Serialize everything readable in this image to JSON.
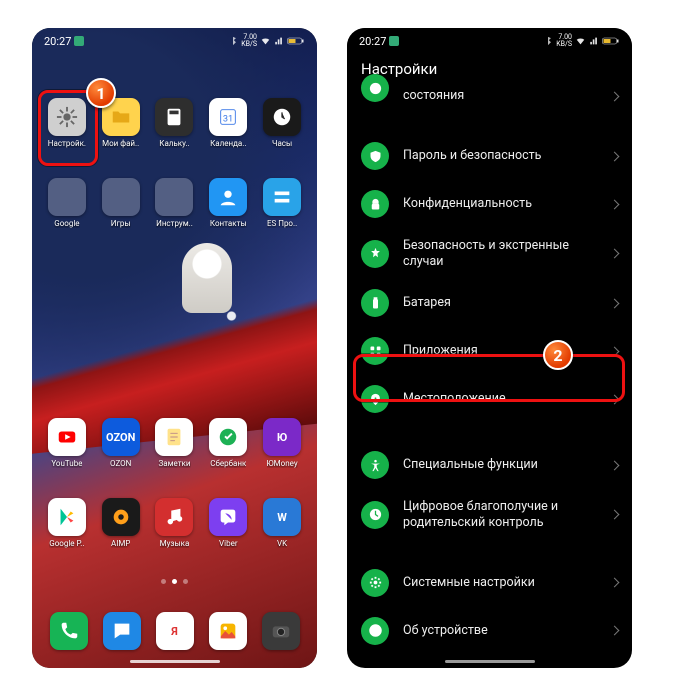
{
  "status": {
    "time": "20:27",
    "speed_top": "7.00",
    "speed_bottom": "KB/S"
  },
  "home": {
    "row1": [
      {
        "name": "settings",
        "label": "Настройк.",
        "bg": "#cfcfcf",
        "glyph": "gear"
      },
      {
        "name": "my-files",
        "label": "Мои фай..",
        "bg": "#ffd34d",
        "glyph": "folder"
      },
      {
        "name": "calculator",
        "label": "Кальку..",
        "bg": "#2e2e2e",
        "glyph": "calc"
      },
      {
        "name": "calendar",
        "label": "Календа..",
        "bg": "#ffffff",
        "glyph": "cal"
      },
      {
        "name": "clock",
        "label": "Часы",
        "bg": "#1a1a1a",
        "glyph": "clock"
      }
    ],
    "row2": [
      {
        "name": "google-folder",
        "label": "Google",
        "folder": true
      },
      {
        "name": "games-folder",
        "label": "Игры",
        "folder": true
      },
      {
        "name": "tools-folder",
        "label": "Инструм..",
        "folder": true
      },
      {
        "name": "contacts",
        "label": "Контакты",
        "bg": "#2196f3",
        "glyph": "contact"
      },
      {
        "name": "es-explorer",
        "label": "ES Про..",
        "bg": "#29a3e8",
        "glyph": "es"
      }
    ],
    "row3": [
      {
        "name": "youtube",
        "label": "YouTube",
        "bg": "#ffffff",
        "glyph": "yt"
      },
      {
        "name": "ozon",
        "label": "OZON",
        "bg": "#0d5bdd",
        "glyph": "ozon",
        "text": "OZON"
      },
      {
        "name": "notes",
        "label": "Заметки",
        "bg": "#ffffff",
        "glyph": "note"
      },
      {
        "name": "sberbank",
        "label": "Сбербанк",
        "bg": "#ffffff",
        "glyph": "sber"
      },
      {
        "name": "yoomoney",
        "label": "ЮMoney",
        "bg": "#7b29c8",
        "glyph": "yoo",
        "text": "Ю"
      }
    ],
    "row4": [
      {
        "name": "google-play",
        "label": "Google P..",
        "bg": "#ffffff",
        "glyph": "play"
      },
      {
        "name": "aimp",
        "label": "AIMP",
        "bg": "#1a1a1a",
        "glyph": "aimp"
      },
      {
        "name": "music",
        "label": "Музыка",
        "bg": "#d32f2f",
        "glyph": "music"
      },
      {
        "name": "viber",
        "label": "Viber",
        "bg": "#7d3ff0",
        "glyph": "viber"
      },
      {
        "name": "vk",
        "label": "VK",
        "bg": "#2979d6",
        "glyph": "vk",
        "text": "W"
      }
    ],
    "dock": [
      {
        "name": "phone",
        "bg": "#17b455",
        "glyph": "phone"
      },
      {
        "name": "messages",
        "bg": "#1f88e5",
        "glyph": "sms"
      },
      {
        "name": "yandex",
        "bg": "#ffffff",
        "glyph": "y",
        "text": "Я"
      },
      {
        "name": "gallery",
        "bg": "#ffffff",
        "glyph": "gallery"
      },
      {
        "name": "camera",
        "bg": "#3a3a3a",
        "glyph": "cam"
      }
    ]
  },
  "settings": {
    "title": "Настройки",
    "items": [
      {
        "id": "status",
        "label": "состояния",
        "icon": "status",
        "partial": true
      },
      {
        "id": "password",
        "label": "Пароль и безопасность",
        "icon": "shield"
      },
      {
        "id": "privacy",
        "label": "Конфиденциальность",
        "icon": "lock"
      },
      {
        "id": "emergency",
        "label": "Безопасность и экстренные случаи",
        "icon": "star"
      },
      {
        "id": "battery",
        "label": "Батарея",
        "icon": "battery"
      },
      {
        "id": "apps",
        "label": "Приложения",
        "icon": "grid",
        "highlighted": true
      },
      {
        "id": "location",
        "label": "Местоположение",
        "icon": "pin"
      },
      {
        "id": "special",
        "label": "Специальные функции",
        "icon": "accessibility"
      },
      {
        "id": "wellbeing",
        "label": "Цифровое благополучие и родительский контроль",
        "icon": "wellbeing"
      },
      {
        "id": "system",
        "label": "Системные настройки",
        "icon": "gear"
      },
      {
        "id": "about",
        "label": "Об устройстве",
        "icon": "info",
        "partial": true
      }
    ]
  },
  "badges": {
    "one": "1",
    "two": "2"
  },
  "colors": {
    "accent": "#16b24a",
    "highlight": "#e11",
    "badge": "#e84a00"
  }
}
